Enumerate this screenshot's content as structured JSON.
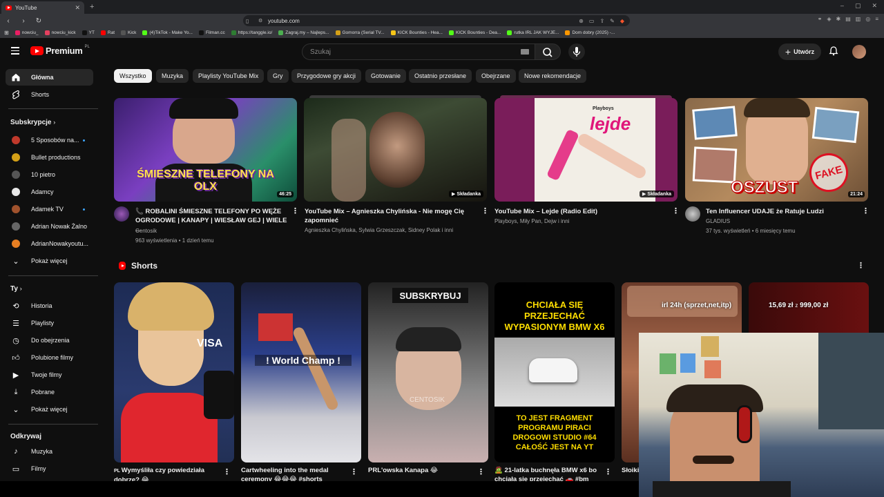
{
  "browser": {
    "tab_title": "YouTube",
    "url": "youtube.com",
    "bookmarks": [
      "nowciu_",
      "nowciu_kick",
      "YT",
      "Rat",
      "Kick",
      "(4)TikTok - Make Yo...",
      "Filman.cc",
      "https://tanggle.io/",
      "Zagraj.my – Najleps...",
      "Gomorra (Serial TV...",
      "KICK Bounties - Hea...",
      "KICK Bounties - Dea...",
      "rutka IRL JAK WYJE...",
      "Dom dobry (2025) -..."
    ]
  },
  "header": {
    "logo_text": "Premium",
    "logo_country": "PL",
    "search_placeholder": "Szukaj",
    "create_label": "Utwórz"
  },
  "sidebar": {
    "main": [
      {
        "label": "Główna",
        "icon": "home-icon"
      },
      {
        "label": "Shorts",
        "icon": "shorts-icon"
      }
    ],
    "subscriptions_title": "Subskrypcje",
    "subscriptions": [
      {
        "label": "5 Sposobów na...",
        "color": "#c0392b",
        "dot": true
      },
      {
        "label": "Bullet productions",
        "color": "#d4a017",
        "dot": false
      },
      {
        "label": "10 pietro",
        "color": "#555555",
        "dot": false
      },
      {
        "label": "Adamcy",
        "color": "#e8e8e8",
        "dot": false
      },
      {
        "label": "Adamek TV",
        "color": "#a0522d",
        "dot": true
      },
      {
        "label": "Adrian Nowak Żalno",
        "color": "#666666",
        "dot": false
      },
      {
        "label": "AdrianNowakyoutu...",
        "color": "#e67e22",
        "dot": false
      }
    ],
    "show_more_1": "Pokaż więcej",
    "you_title": "Ty",
    "you_items": [
      {
        "label": "Historia",
        "icon": "history-icon"
      },
      {
        "label": "Playlisty",
        "icon": "playlist-icon"
      },
      {
        "label": "Do obejrzenia",
        "icon": "watch-later-icon"
      },
      {
        "label": "Polubione filmy",
        "icon": "like-icon"
      },
      {
        "label": "Twoje filmy",
        "icon": "your-videos-icon"
      },
      {
        "label": "Pobrane",
        "icon": "download-icon"
      }
    ],
    "show_more_2": "Pokaż więcej",
    "explore_title": "Odkrywaj",
    "explore_items": [
      {
        "label": "Muzyka",
        "icon": "music-icon"
      },
      {
        "label": "Filmy",
        "icon": "movies-icon"
      }
    ]
  },
  "chips": [
    "Wszystko",
    "Muzyka",
    "Playlisty YouTube Mix",
    "Gry",
    "Przygodowe gry akcji",
    "Gotowanie",
    "Ostatnio przesłane",
    "Obejrzane",
    "Nowe rekomendacje"
  ],
  "videos": [
    {
      "title_l1": "📞 ROBALINI ŚMIESZNE TELEFONY PO WĘŻE",
      "title_l2": "OGRODOWE | KANAPY | WIESŁAW GEJ | WIELE ...",
      "channel": "Centosik",
      "stats": "963 wyświetlenia • 1 dzień temu",
      "badge": "46:25",
      "thumb_text": "ŚMIESZNE TELEFONY NA OLX"
    },
    {
      "title_l1": "YouTube Mix – Agnieszka Chylińska - Nie mogę Cię",
      "title_l2": "zapomnieć",
      "channel": "Agnieszka Chylińska, Sylwia Grzeszczak, Sidney Polak i inni",
      "stats": "",
      "badge": "Składanka"
    },
    {
      "title_l1": "YouTube Mix – Lejde (Radio Edit)",
      "title_l2": "",
      "channel": "Playboys, Miły Pan, Dejw i inni",
      "stats": "",
      "badge": "Składanka",
      "thumb_brand": "Playboys",
      "thumb_text": "lejde"
    },
    {
      "title_l1": "Ten Influencer UDAJE że Ratuje Ludzi",
      "title_l2": "",
      "channel": "GLADIUS",
      "stats": "37 tys. wyświetleń • 6 miesięcy temu",
      "badge": "21:24",
      "thumb_text": "OSZUST",
      "stamp": "FAKE"
    }
  ],
  "shorts_title": "Shorts",
  "shorts": [
    {
      "title_l1": "Wymyśliła czy powiedziała",
      "title_l2": "dobrze? 😂"
    },
    {
      "title_l1": "Cartwheeling into the medal",
      "title_l2": "ceremony 😂😂😂 #shorts",
      "overlay": "! World Champ !"
    },
    {
      "title_l1": "PRL'owska Kanapa 😂",
      "title_l2": "",
      "overlay": "SUBSKRYBUJ",
      "watermark": "CENTOSIK"
    },
    {
      "title_l1": "🧟 21-latka buchnęła BMW x6 bo",
      "title_l2": "chciała się przejechać 🚗 #bm",
      "overlay_top": "CHCIAŁA SIĘ PRZEJECHAĆ WYPASIONYM BMW X6",
      "overlay_bottom": "TO JEST FRAGMENT PROGRAMU PIRACI DROGOWI STUDIO #64 CAŁOŚĆ JEST NA YT"
    },
    {
      "title_l1": "Słoiki",
      "title_l2": ""
    }
  ],
  "stream_overlay": {
    "text_a": "irl 24h (sprzet,net,itp)",
    "text_b": "15,69 zł",
    "text_c": "z",
    "text_d": "999,00 zł"
  }
}
